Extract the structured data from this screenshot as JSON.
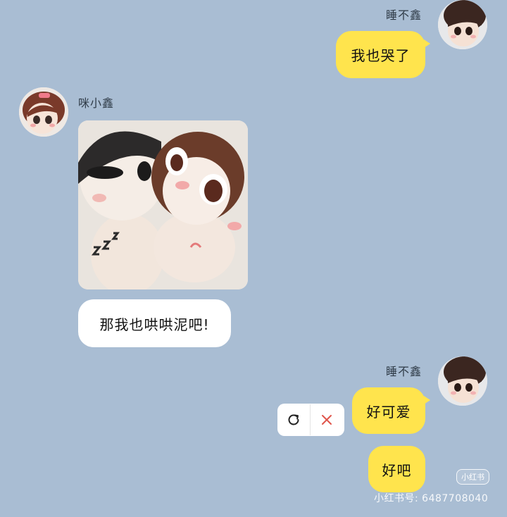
{
  "messages": [
    {
      "sender": "睡不鑫",
      "text": "我也哭了"
    },
    {
      "sender": "咪小鑫"
    },
    {
      "text": "那我也哄哄泥吧!"
    },
    {
      "sender": "睡不鑫",
      "text": "好可爱"
    },
    {
      "text": "好吧"
    }
  ],
  "watermark": {
    "badge": "小红书",
    "id": "小红书号: 6487708040"
  },
  "colors": {
    "background": "#a9bdd3",
    "sent_bubble": "#ffe44d",
    "received_bubble": "#ffffff",
    "cancel_icon": "#e0554b"
  }
}
